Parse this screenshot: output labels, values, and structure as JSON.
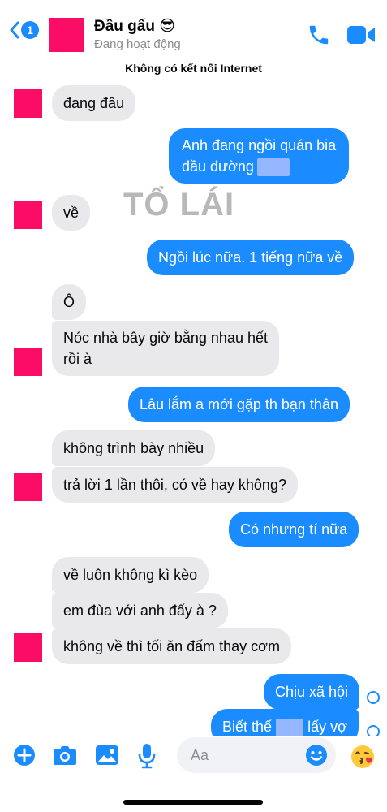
{
  "header": {
    "back_badge": "1",
    "contact_name": "Đầu gấu 😎",
    "status": "Đang hoạt động",
    "phone_icon": "phone-icon",
    "video_icon": "video-camera-icon"
  },
  "connection_banner": "Không có kết nối Internet",
  "watermark": "TỔ LÁI",
  "messages": [
    {
      "from": "them",
      "text": "đang đâu"
    },
    {
      "from": "me",
      "line1": "Anh đang ngồi quán bia",
      "line2": "đầu đường"
    },
    {
      "from": "them",
      "text": "về"
    },
    {
      "from": "me",
      "text": "Ngồi lúc nữa. 1 tiếng nữa về"
    },
    {
      "from": "them",
      "text": "Ô"
    },
    {
      "from": "them",
      "line1": "Nóc nhà bây giờ bằng nhau hết",
      "line2": "rồi à"
    },
    {
      "from": "me",
      "text": "Lâu lắm a mới gặp th bạn thân"
    },
    {
      "from": "them",
      "text": "không trình bày nhiều"
    },
    {
      "from": "them",
      "text": "trả lời 1 lần thôi, có về hay không?"
    },
    {
      "from": "me",
      "text": "Có nhưng tí nữa"
    },
    {
      "from": "them",
      "text": "về luôn không kì kèo"
    },
    {
      "from": "them",
      "text": "em đùa với anh đấy à ?"
    },
    {
      "from": "them",
      "text": "không về thì tối ăn đấm thay cơm"
    },
    {
      "from": "me",
      "text": "Chịu xã hội"
    },
    {
      "from": "me",
      "text_before": "Biết thế",
      "text_after": "lấy vợ"
    }
  ],
  "composer": {
    "placeholder": "Aa",
    "emoji_button": "🙂",
    "reaction_emoji": "😘"
  },
  "colors": {
    "accent": "#1a8cff",
    "incoming_bubble": "#e9e9eb",
    "avatar_placeholder": "#fb0d67"
  }
}
